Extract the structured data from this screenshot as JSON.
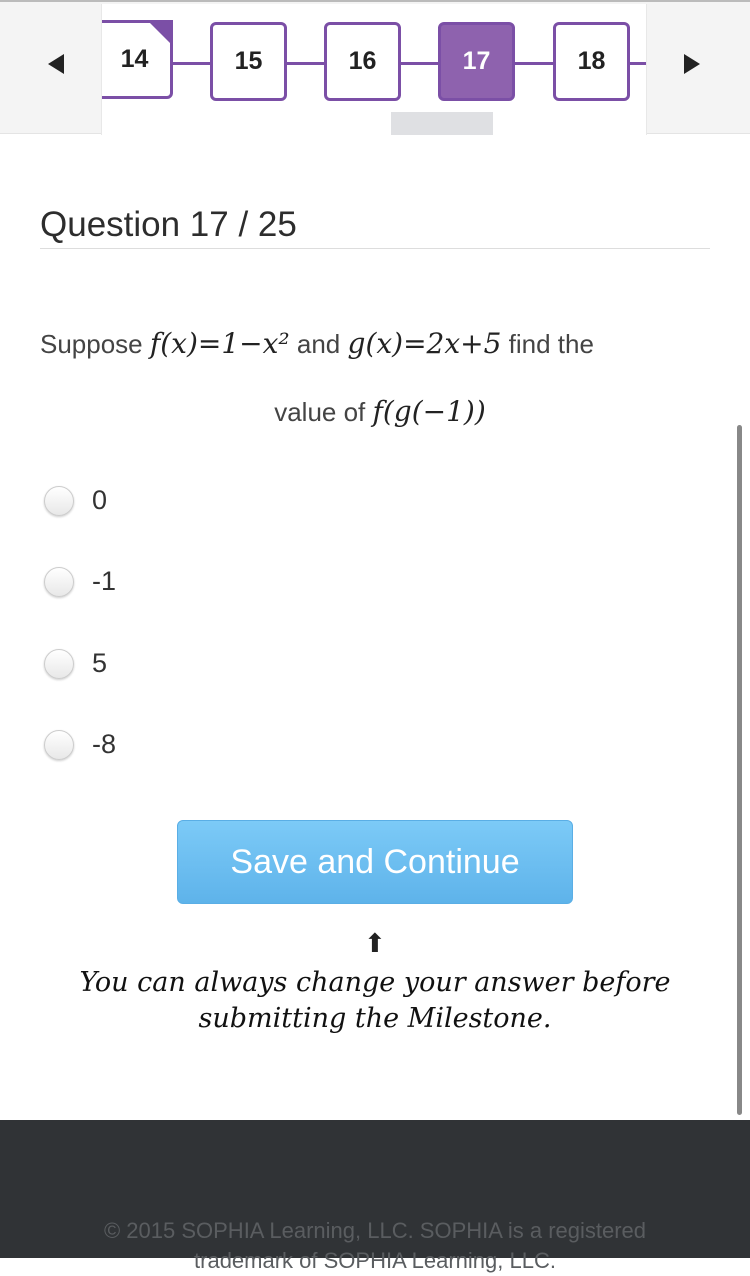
{
  "nav": {
    "questions": [
      {
        "number": "14",
        "state": "answered"
      },
      {
        "number": "15",
        "state": "default"
      },
      {
        "number": "16",
        "state": "default"
      },
      {
        "number": "17",
        "state": "current"
      },
      {
        "number": "18",
        "state": "default"
      }
    ],
    "accent_color": "#7b4fa6"
  },
  "question": {
    "heading": "Question 17 / 25",
    "text_before": "Suppose",
    "f_expr": "f(x)=1−x²",
    "and": "and",
    "g_expr": "g(x)=2x+5",
    "text_mid": "find the",
    "line2": "value of",
    "target_expr": "f(g(−1))"
  },
  "options": [
    "0",
    "-1",
    "5",
    "-8"
  ],
  "save_button": "Save and Continue",
  "note": {
    "line1": "You can always change your answer before",
    "line2": "submitting the Milestone."
  },
  "footer": {
    "line1": "© 2015 SOPHIA Learning, LLC. SOPHIA is a registered",
    "line2": "trademark of SOPHIA Learning, LLC."
  }
}
